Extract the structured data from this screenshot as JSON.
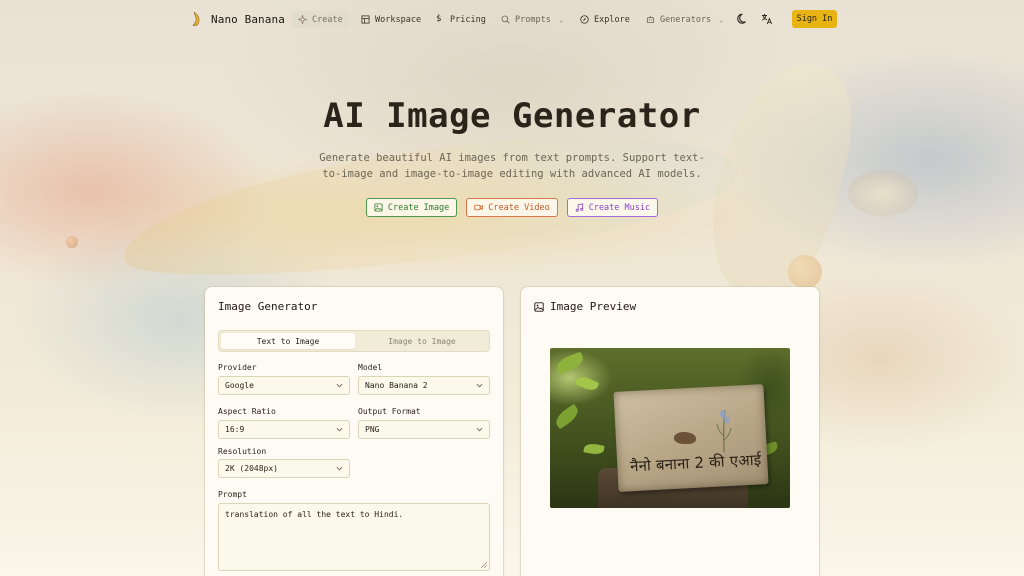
{
  "brand": {
    "name": "Nano Banana"
  },
  "nav": {
    "items": [
      {
        "label": "Create",
        "icon": "sparkles-icon"
      },
      {
        "label": "Workspace",
        "icon": "layout-icon"
      },
      {
        "label": "Pricing",
        "icon": "dollar-icon"
      },
      {
        "label": "Prompts",
        "icon": "search-icon"
      },
      {
        "label": "Explore",
        "icon": "compass-icon"
      },
      {
        "label": "Generators",
        "icon": "robot-icon"
      }
    ],
    "sign_in": "Sign In"
  },
  "hero": {
    "title": "AI Image Generator",
    "subtitle_line1": "Generate beautiful AI images from text prompts. Support text-",
    "subtitle_line2": "to-image and image-to-image editing with advanced AI models.",
    "cta": {
      "image": "Create Image",
      "video": "Create Video",
      "music": "Create Music"
    }
  },
  "generator": {
    "title": "Image Generator",
    "tabs": [
      "Text to Image",
      "Image to Image"
    ],
    "provider": {
      "label": "Provider",
      "value": "Google"
    },
    "model": {
      "label": "Model",
      "value": "Nano Banana 2"
    },
    "aspect_ratio": {
      "label": "Aspect Ratio",
      "value": "16:9"
    },
    "output_format": {
      "label": "Output Format",
      "value": "PNG"
    },
    "resolution": {
      "label": "Resolution",
      "value": "2K (2048px)"
    },
    "prompt": {
      "label": "Prompt",
      "value": "translation of all the text to Hindi."
    }
  },
  "preview": {
    "title": "Image Preview",
    "sign_text": "नैनो बनाना 2 की एआई"
  },
  "colors": {
    "accent": "#e8b414",
    "cta_image": "#2f7d2f",
    "cta_video": "#c55a28",
    "cta_music": "#8a44c8"
  }
}
